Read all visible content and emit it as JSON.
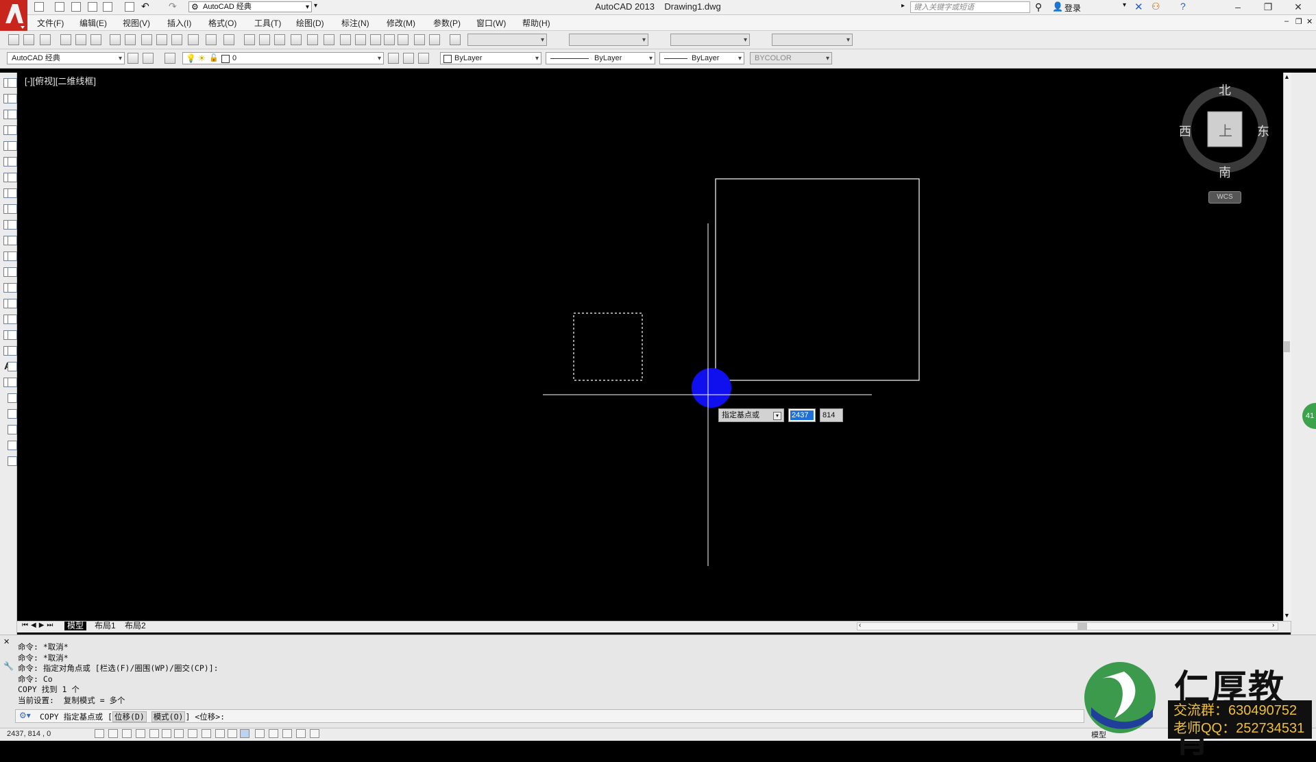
{
  "title_bar": {
    "app_name": "AutoCAD 2013",
    "file_name": "Drawing1.dwg",
    "workspace": "AutoCAD 经典",
    "search_placeholder": "键入关键字或短语",
    "login_label": "登录"
  },
  "menu": {
    "items": [
      "文件(F)",
      "编辑(E)",
      "视图(V)",
      "插入(I)",
      "格式(O)",
      "工具(T)",
      "绘图(D)",
      "标注(N)",
      "修改(M)",
      "参数(P)",
      "窗口(W)",
      "帮助(H)"
    ]
  },
  "toolbar2": {
    "workspace": "AutoCAD 经典",
    "layer": "0",
    "color": "ByLayer",
    "linetype": "ByLayer",
    "lineweight": "ByLayer",
    "plotstyle": "BYCOLOR"
  },
  "viewport": {
    "label": "[-][俯视][二维线框]"
  },
  "viewcube": {
    "north": "北",
    "south": "南",
    "east": "东",
    "west": "西",
    "top_face": "上",
    "wcs": "WCS"
  },
  "dynamic_input": {
    "prompt": "指定基点或",
    "x_value": "2437",
    "y_value": "814"
  },
  "tabs": {
    "items": [
      "模型",
      "布局1",
      "布局2"
    ],
    "active_index": 0
  },
  "command_window": {
    "history": [
      "命令: *取消*",
      "命令: *取消*",
      "命令: 指定对角点或 [栏选(F)/圈围(WP)/圈交(CP)]:",
      "命令: Co",
      "COPY 找到 1 个",
      "当前设置:  复制模式 = 多个"
    ],
    "input_prefix": "COPY 指定基点或 [",
    "input_opt1": "位移(D)",
    "input_opt2": "模式(O)",
    "input_suffix": "] <位移>:"
  },
  "status_bar": {
    "coordinates": "2437, 814 , 0",
    "model_label": "模型"
  },
  "watermark": {
    "brand": "仁厚教育",
    "group_label": "交流群：630490752",
    "qq_label": "老师QQ：252734531"
  },
  "colors": {
    "canvas": "#000000",
    "cursor_marker": "#1010ee",
    "dyn_input_highlight": "#1f6fd8",
    "brand_gold": "#f0c030"
  }
}
